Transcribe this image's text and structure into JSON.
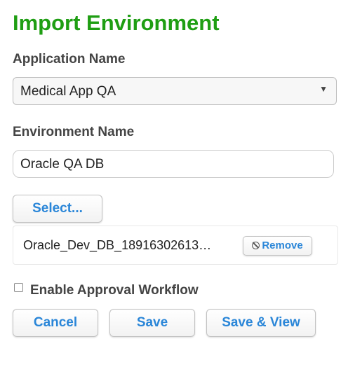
{
  "page": {
    "title": "Import Environment"
  },
  "form": {
    "application_label": "Application Name",
    "application_value": "Medical App QA",
    "dropdown_arrow": "▼",
    "environment_label": "Environment Name",
    "environment_value": "Oracle QA DB",
    "select_button": "Select...",
    "file": {
      "name": "Oracle_Dev_DB_18916302613…",
      "remove_label": "Remove"
    },
    "approval_checkbox": {
      "label": "Enable Approval Workflow",
      "checked": false
    }
  },
  "actions": {
    "cancel_label": "Cancel",
    "save_label": "Save",
    "save_view_label": "Save & View"
  },
  "colors": {
    "title": "#1f9e13",
    "button_text": "#2a86d8"
  },
  "icons": {
    "remove": "ban-icon",
    "dropdown": "triangle-down-icon"
  }
}
